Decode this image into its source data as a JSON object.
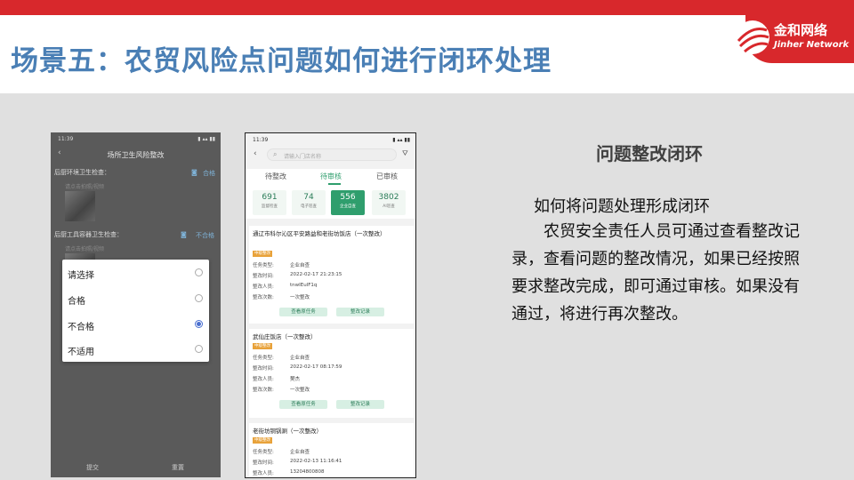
{
  "slide": {
    "title": "场景五：农贸风险点问题如何进行闭环处理",
    "logo_cn": "金和网络",
    "logo_en": "Jinher Network"
  },
  "phone1": {
    "status_time": "11:39",
    "status_right": "▮ ▴▴ ▮▮",
    "nav_title": "场所卫生风险整改",
    "items": [
      {
        "label": "后厨环境卫生检查：",
        "result": "合格",
        "hint": "请点击拍照/视频"
      },
      {
        "label": "后厨工具容器卫生检查：",
        "result": "不合格",
        "hint": "请点击拍照/视频"
      }
    ],
    "dropdown": [
      "请选择",
      "合格",
      "不合格",
      "不适用"
    ],
    "dropdown_selected": 2,
    "submit_label": "提交",
    "reset_label": "重置"
  },
  "phone2": {
    "status_time": "11:39",
    "status_right": "▮ ▴▴ ▮▮",
    "search_placeholder": "请输入门店名称",
    "tabs": [
      "待整改",
      "待审核",
      "已审核"
    ],
    "active_tab": 1,
    "stats": [
      {
        "value": "691",
        "label": "监督检查"
      },
      {
        "value": "74",
        "label": "电子巡查"
      },
      {
        "value": "556",
        "label": "企业自查"
      },
      {
        "value": "3802",
        "label": "AI巡查"
      }
    ],
    "active_stat": 2,
    "field_labels": {
      "type": "任务类型:",
      "time": "整改时间:",
      "person": "整改人员:",
      "count": "整改次数:"
    },
    "btn_view": "查看原任务",
    "btn_record": "整改记录",
    "cards": [
      {
        "name": "通辽市科尔沁区平安路益和老街坊饭店（一次整改）",
        "badge": "中级整改",
        "type": "企业自查",
        "time": "2022-02-17 21:23:15",
        "person": "tnwIEulF1q",
        "count": "一次整改"
      },
      {
        "name": "武仙庄饭店（一次整改）",
        "badge": "中级整改",
        "type": "企业自查",
        "time": "2022-02-17 08:17:59",
        "person": "樊杰",
        "count": "一次整改"
      },
      {
        "name": "老街坊铜锅涮（一次整改）",
        "badge": "中级整改",
        "type": "企业自查",
        "time": "2022-02-13 11:16:41",
        "person": "13204800808"
      }
    ]
  },
  "right": {
    "heading": "问题整改闭环",
    "lead": "如何将问题处理形成闭环",
    "paragraph": "农贸安全责任人员可通过查看整改记录，查看问题的整改情况，如果已经按照要求整改完成，即可通过审核。如果没有通过，将进行再次整改。"
  },
  "colors": {
    "brand_red": "#d8282c",
    "title_blue": "#4a7fb5",
    "app_green": "#2f9e6d"
  }
}
